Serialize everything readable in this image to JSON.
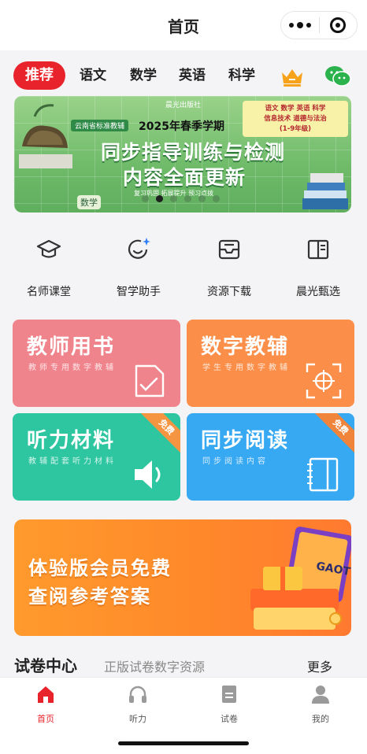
{
  "header": {
    "title": "首页"
  },
  "tabs": [
    {
      "label": "推荐",
      "active": true
    },
    {
      "label": "语文"
    },
    {
      "label": "数学"
    },
    {
      "label": "英语"
    },
    {
      "label": "科学"
    }
  ],
  "banner": {
    "publisher": "晨光出版社",
    "region": "云南省标准教辅",
    "term": "2025年春季学期",
    "headline1": "同步指导训练与检测",
    "headline2": "内容全面更新",
    "tagline": "复习巩固 拓展提升 预习点拨",
    "subjects_line1": "语文 数学 英语 科学",
    "subjects_line2": "信息技术 道德与法治",
    "subjects_line3": "(1-9年级)",
    "subject_badge": "数学",
    "slide_count": 6,
    "active_slide": 2
  },
  "quick_actions": [
    {
      "label": "名师课堂",
      "icon": "graduation-cap-icon"
    },
    {
      "label": "智学助手",
      "icon": "ai-assistant-icon"
    },
    {
      "label": "资源下载",
      "icon": "inbox-download-icon"
    },
    {
      "label": "晨光甄选",
      "icon": "open-book-icon"
    }
  ],
  "cards": [
    {
      "title": "教师用书",
      "subtitle": "教师专用数字教辅",
      "icon": "document-check-icon",
      "color": "#f0848c"
    },
    {
      "title": "数字教辅",
      "subtitle": "学生专用数字教辅",
      "icon": "scan-target-icon",
      "color": "#fb8e48"
    },
    {
      "title": "听力材料",
      "subtitle": "教辅配套听力材料",
      "icon": "speaker-icon",
      "ribbon": "免费",
      "color": "#2ec6a0"
    },
    {
      "title": "同步阅读",
      "subtitle": "同步阅读内容",
      "icon": "notebook-icon",
      "ribbon": "免费",
      "color": "#37a8f2"
    }
  ],
  "promo": {
    "line1": "体验版会员免费",
    "line2": "查阅参考答案",
    "book_label": "GAOT"
  },
  "section": {
    "title": "试卷中心",
    "desc": "正版试卷数字资源",
    "more": "更多"
  },
  "bottom_nav": [
    {
      "label": "首页",
      "icon": "home-icon",
      "active": true
    },
    {
      "label": "听力",
      "icon": "headphones-icon"
    },
    {
      "label": "试卷",
      "icon": "exam-paper-icon"
    },
    {
      "label": "我的",
      "icon": "user-icon"
    }
  ],
  "colors": {
    "accent": "#e8232b",
    "background": "#f4f4f6"
  }
}
